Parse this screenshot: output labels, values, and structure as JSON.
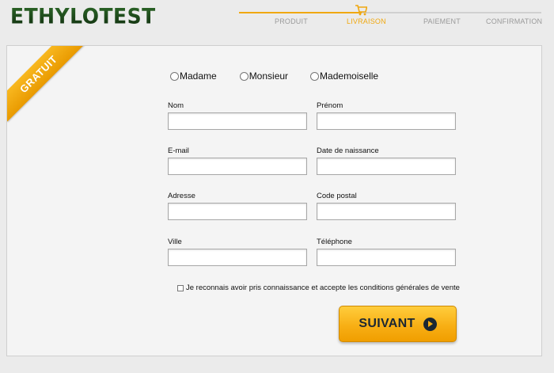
{
  "header": {
    "logo": "ETHYLOTEST",
    "steps": [
      "PRODUIT",
      "LIVRAISON",
      "PAIEMENT",
      "CONFIRMATION"
    ],
    "active_step": "LIVRAISON",
    "accent_color": "#f0a810"
  },
  "form": {
    "ribbon": "GRATUIT",
    "civility": [
      "Madame",
      "Monsieur",
      "Mademoiselle"
    ],
    "fields": {
      "nom": "Nom",
      "prenom": "Prénom",
      "email": "E-mail",
      "naissance": "Date de naissance",
      "adresse": "Adresse",
      "code_postal": "Code postal",
      "ville": "Ville",
      "telephone": "Téléphone"
    },
    "terms": "Je reconnais avoir pris connaissance et accepte les conditions générales de vente",
    "submit": "SUIVANT"
  }
}
